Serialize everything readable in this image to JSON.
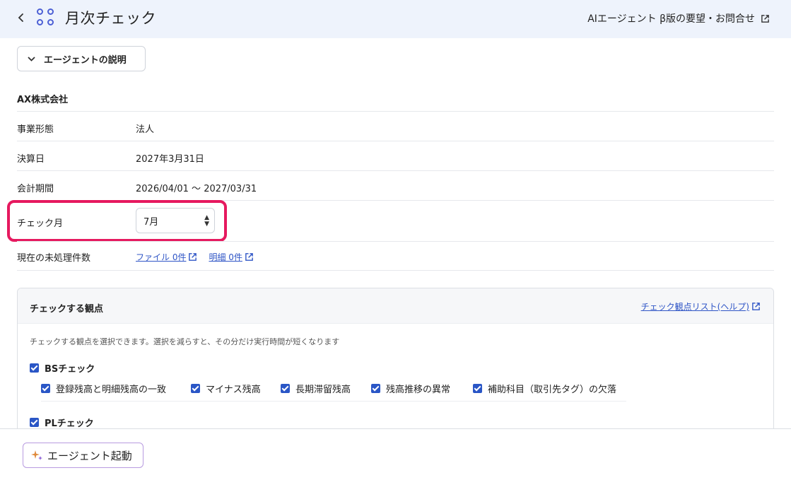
{
  "header": {
    "title": "月次チェック",
    "feedback_label": "AIエージェント β版の要望・お問合せ",
    "accent_color": "#4c5fd5"
  },
  "description_toggle": {
    "label": "エージェントの説明"
  },
  "company": {
    "name": "AX株式会社"
  },
  "info_rows": [
    {
      "label": "事業形態",
      "value": "法人"
    },
    {
      "label": "決算日",
      "value": "2027年3月31日"
    },
    {
      "label": "会計期間",
      "value": "2026/04/01 〜 2027/03/31"
    },
    {
      "label": "チェック月",
      "selected_value": "7月"
    },
    {
      "label": "現在の未処理件数",
      "file_link": "ファイル 0件",
      "detail_link": "明細 0件"
    }
  ],
  "checks_panel": {
    "title": "チェックする観点",
    "help_link": "チェック観点リスト(ヘルプ)",
    "description": "チェックする観点を選択できます。選択を減らすと、その分だけ実行時間が短くなります",
    "groups": [
      {
        "label": "BSチェック",
        "checked": true,
        "items": [
          {
            "label": "登録残高と明細残高の一致",
            "checked": true
          },
          {
            "label": "マイナス残高",
            "checked": true
          },
          {
            "label": "長期滞留残高",
            "checked": true
          },
          {
            "label": "残高推移の異常",
            "checked": true
          },
          {
            "label": "補助科目（取引先タグ）の欠落",
            "checked": true
          }
        ]
      },
      {
        "label": "PLチェック",
        "checked": true,
        "items": []
      }
    ]
  },
  "footer": {
    "run_label": "エージェント起動"
  },
  "highlight_color": "#e6195f"
}
